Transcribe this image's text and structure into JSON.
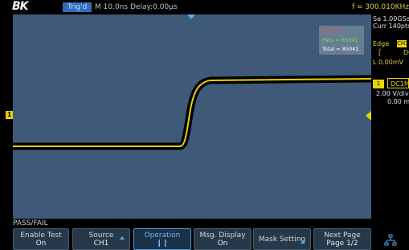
{
  "header": {
    "brand": "BK",
    "trigger_status": "Trig'd",
    "timebase": "M 10.0ns",
    "delay": "Delay:0.00μs",
    "frequency": "f = 300.010KHz"
  },
  "acquisition": {
    "sample_rate": "Sa 1.00GSa/s",
    "memory": "Curr 140pts"
  },
  "trigger": {
    "type": "Edge",
    "source_badge": "CH1",
    "slope_icon": "rising-edge-icon",
    "coupling": "DC",
    "level": "L  0.00mV"
  },
  "channel": {
    "number": "1",
    "coupling": "DC1M",
    "scale": "2.00 V/div",
    "offset": "0.00 mV",
    "marker_label": "1"
  },
  "passfail": {
    "fail": "Fail = 0",
    "pass": "Pass = 85041",
    "total": "Total = 85041"
  },
  "menu": {
    "title": "PASS/FAIL",
    "buttons": [
      {
        "label": "Enable Test",
        "value": "On"
      },
      {
        "label": "Source",
        "value": "CH1"
      },
      {
        "label": "Operation",
        "value": "❙❙"
      },
      {
        "label": "Msg. Display",
        "value": "On"
      },
      {
        "label": "Mask Setting",
        "value": ""
      },
      {
        "label": "Next Page",
        "value": "Page 1/2"
      }
    ]
  },
  "icons": {
    "network": "network-icon"
  },
  "colors": {
    "screen_bg": "#3e5a78",
    "trace": "#e8d400",
    "accent": "#4ab0ff"
  }
}
